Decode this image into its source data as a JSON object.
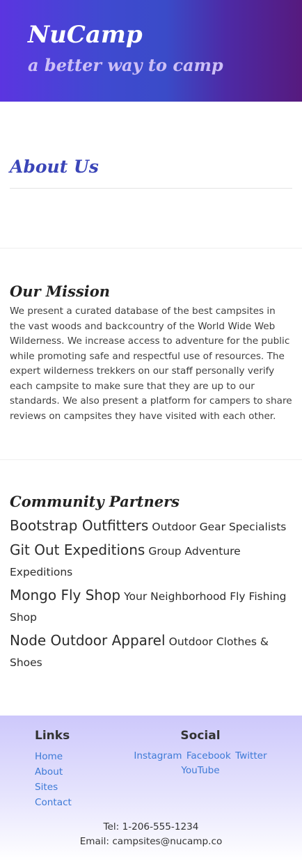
{
  "header": {
    "brand": "NuCamp",
    "tagline": "a better way to camp"
  },
  "about": {
    "title": "About Us"
  },
  "mission": {
    "title": "Our Mission",
    "text": "We present a curated database of the best campsites in the vast woods and backcountry of the World Wide Web Wilderness. We increase access to adventure for the public while promoting safe and respectful use of resources. The expert wilderness trekkers on our staff personally verify each campsite to make sure that they are up to our standards. We also present a platform for campers to share reviews on campsites they have visited with each other."
  },
  "partners": {
    "title": "Community Partners",
    "items": [
      {
        "name": "Bootstrap Outfitters",
        "desc": "Outdoor Gear Specialists"
      },
      {
        "name": "Git Out Expeditions",
        "desc": "Group Adventure Expeditions"
      },
      {
        "name": "Mongo Fly Shop",
        "desc": "Your Neighborhood Fly Fishing Shop"
      },
      {
        "name": "Node Outdoor Apparel",
        "desc": "Outdoor Clothes & Shoes"
      }
    ]
  },
  "footer": {
    "links_heading": "Links",
    "links": [
      "Home",
      "About",
      "Sites",
      "Contact"
    ],
    "social_heading": "Social",
    "social": [
      "Instagram",
      "Facebook",
      "Twitter",
      "YouTube"
    ],
    "tel": "Tel: 1-206-555-1234",
    "email": "Email: campsites@nucamp.co"
  },
  "colors": {
    "header_gradient_start": "#5b35e0",
    "header_gradient_end": "#561a7e",
    "about_title": "#3a45b8",
    "link": "#3d7ad6",
    "footer_top": "#cdc8fb"
  }
}
